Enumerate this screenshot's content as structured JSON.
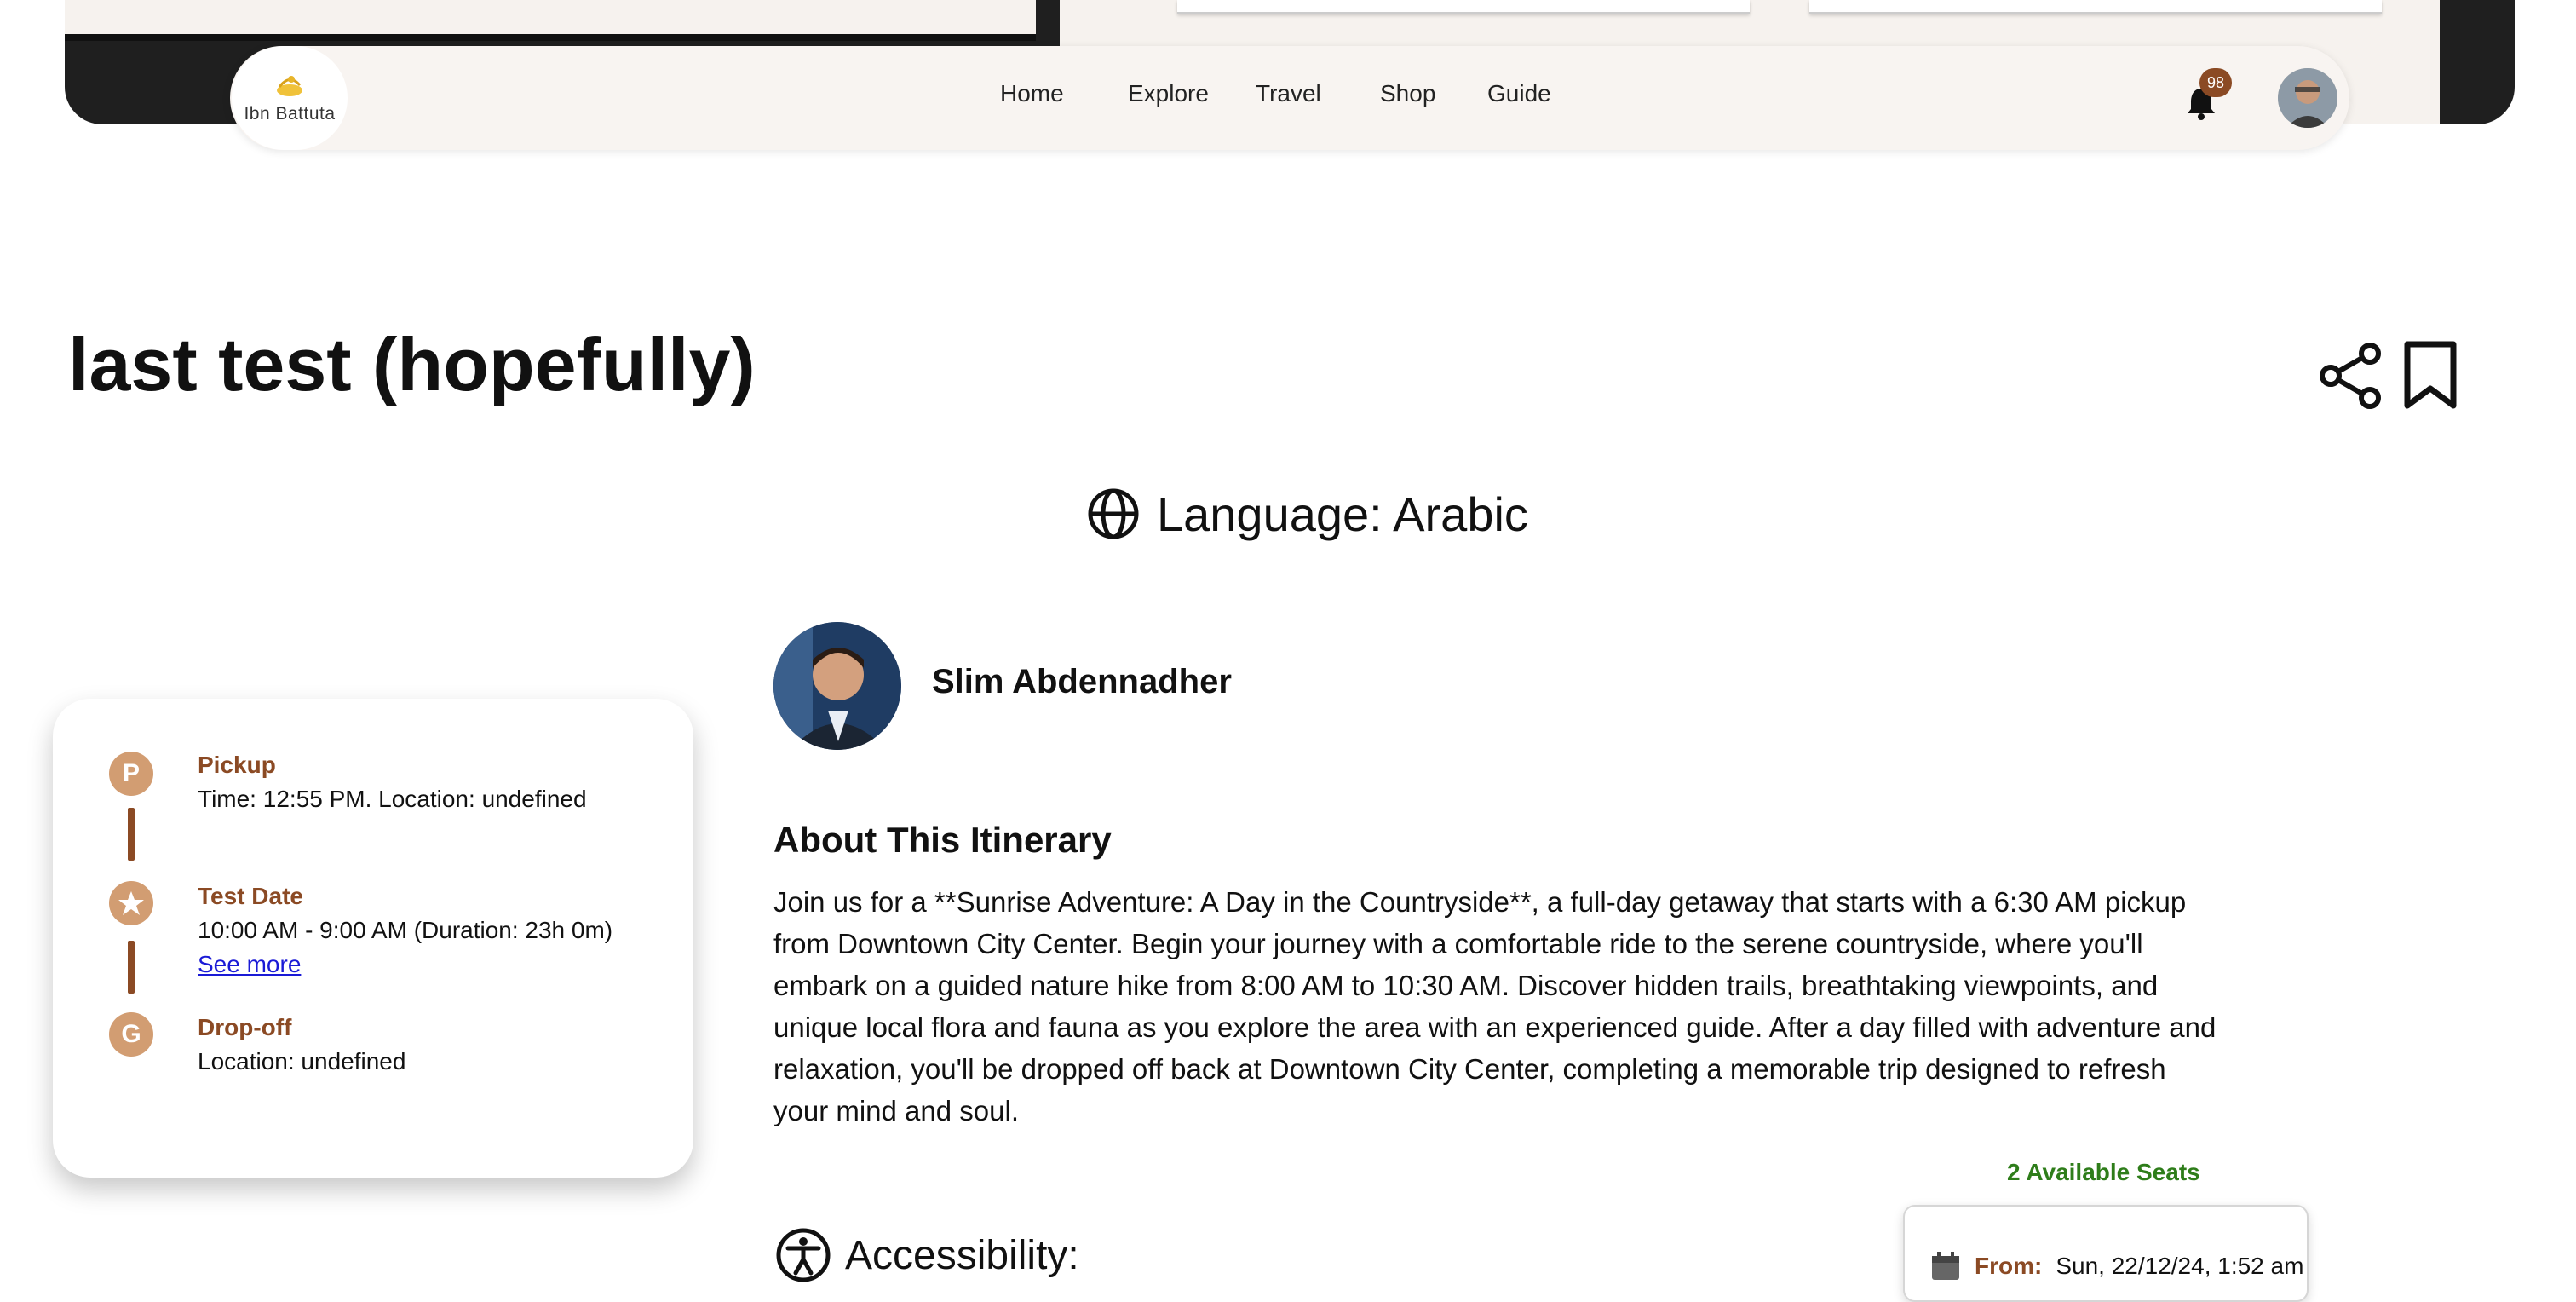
{
  "navbar": {
    "logo_text": "Ibn Battuta",
    "links": [
      "Home",
      "Explore",
      "Travel",
      "Shop",
      "Guide"
    ],
    "notification_count": "98"
  },
  "page": {
    "title": "last test (hopefully)",
    "language": "Language: Arabic"
  },
  "guide": {
    "name": "Slim Abdennadher"
  },
  "about": {
    "title": "About This Itinerary",
    "text": "Join us for a **Sunrise Adventure: A Day in the Countryside**, a full-day getaway that starts with a 6:30 AM pickup from Downtown City Center. Begin your journey with a comfortable ride to the serene countryside, where you'll embark on a guided nature hike from 8:00 AM to 10:30 AM. Discover hidden trails, breathtaking viewpoints, and unique local flora and fauna as you explore the area with an experienced guide. After a day filled with adventure and relaxation, you'll be dropped off back at Downtown City Center, completing a memorable trip designed to refresh your mind and soul."
  },
  "booking": {
    "seats": "2 Available Seats",
    "from_label": "From:",
    "from_value": "Sun, 22/12/24, 1:52 am"
  },
  "accessibility": {
    "label": "Accessibility:"
  },
  "timeline": {
    "pickup": {
      "marker": "P",
      "title": "Pickup",
      "detail": "Time: 12:55 PM. Location: undefined"
    },
    "activity": {
      "title": "Test Date",
      "detail": "10:00 AM - 9:00 AM (Duration: 23h 0m)",
      "link": "See more"
    },
    "dropoff": {
      "marker": "G",
      "title": "Drop-off",
      "detail": "Location: undefined"
    }
  },
  "colors": {
    "accent": "#8b4a24",
    "marker": "#d29d72",
    "seats": "#2e7d1a"
  }
}
